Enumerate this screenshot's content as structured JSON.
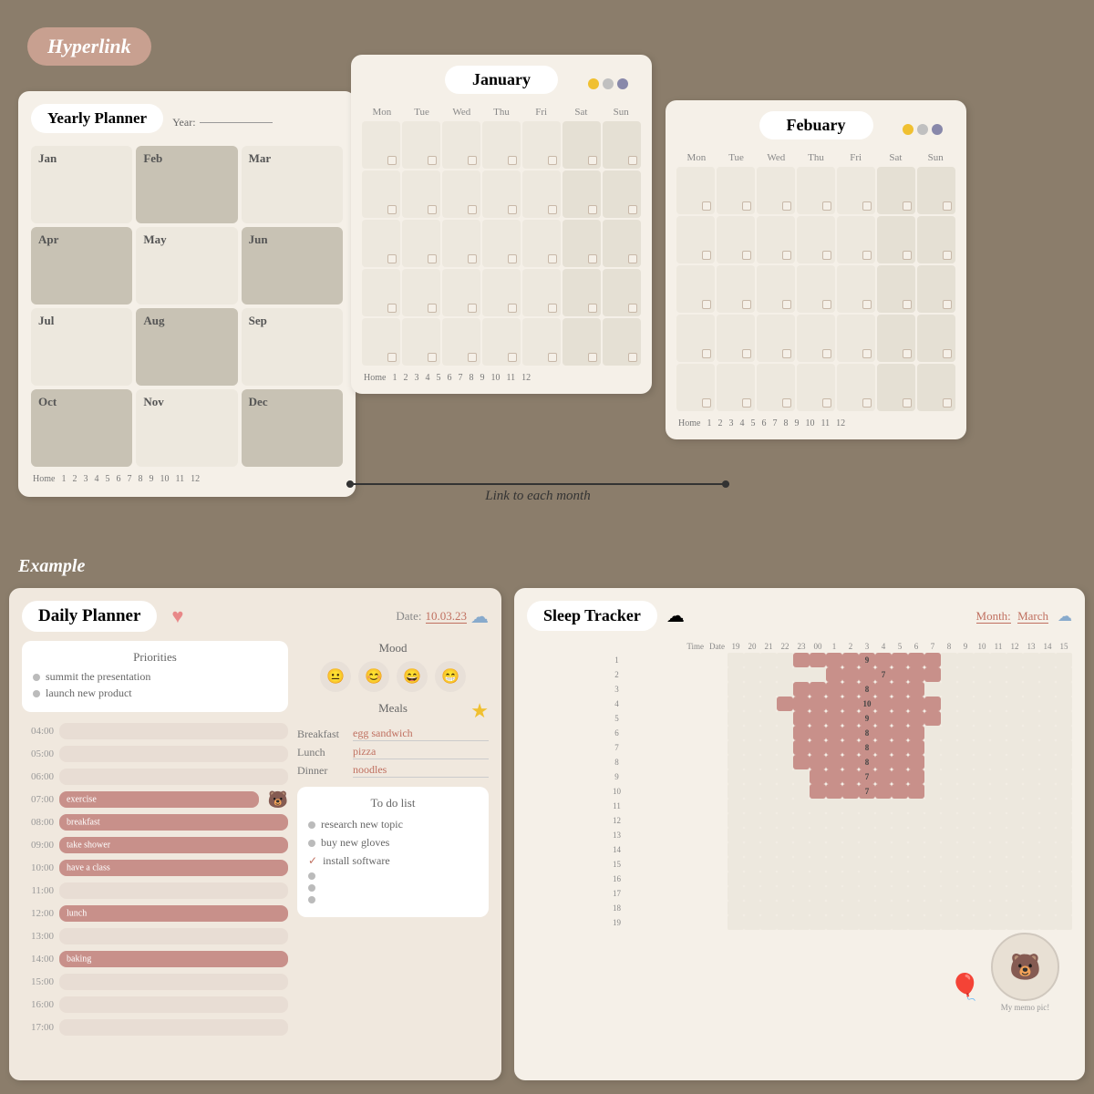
{
  "header": {
    "hyperlink_label": "Hyperlink"
  },
  "yearly_planner": {
    "title": "Yearly Planner",
    "year_label": "Year:",
    "months": [
      {
        "name": "Jan",
        "style": "light"
      },
      {
        "name": "Feb",
        "style": "medium"
      },
      {
        "name": "Mar",
        "style": "light"
      },
      {
        "name": "Apr",
        "style": "medium"
      },
      {
        "name": "May",
        "style": "light"
      },
      {
        "name": "Jun",
        "style": "medium"
      },
      {
        "name": "Jul",
        "style": "light"
      },
      {
        "name": "Aug",
        "style": "medium"
      },
      {
        "name": "Sep",
        "style": "light"
      },
      {
        "name": "Oct",
        "style": "medium"
      },
      {
        "name": "Nov",
        "style": "light"
      },
      {
        "name": "Dec",
        "style": "medium"
      }
    ],
    "nav": [
      "Home",
      "1",
      "2",
      "3",
      "4",
      "5",
      "6",
      "7",
      "8",
      "9",
      "10",
      "11",
      "12"
    ]
  },
  "january_calendar": {
    "title": "January",
    "days": [
      "Mon",
      "Tue",
      "Wed",
      "Thu",
      "Fri",
      "Sat",
      "Sun"
    ],
    "nav": [
      "Home",
      "1",
      "2",
      "3",
      "4",
      "5",
      "6",
      "7",
      "8",
      "9",
      "10",
      "11",
      "12"
    ],
    "controls": [
      {
        "color": "#f0c030"
      },
      {
        "color": "#c0c0c0"
      },
      {
        "color": "#8888aa"
      }
    ]
  },
  "february_calendar": {
    "title": "Febuary",
    "days": [
      "Mon",
      "Tue",
      "Wed",
      "Thu",
      "Fri",
      "Sat",
      "Sun"
    ],
    "nav": [
      "Home",
      "1",
      "2",
      "3",
      "4",
      "5",
      "6",
      "7",
      "8",
      "9",
      "10",
      "11",
      "12"
    ],
    "controls": [
      {
        "color": "#f0c030"
      },
      {
        "color": "#c0c0c0"
      },
      {
        "color": "#8888aa"
      }
    ]
  },
  "link_annotation": {
    "text": "Link to each month"
  },
  "example_label": "Example",
  "daily_planner": {
    "title": "Daily  Planner",
    "date_label": "Date:",
    "date_value": "10.03.23",
    "priorities": {
      "title": "Priorities",
      "items": [
        "summit the presentation",
        "launch new product"
      ]
    },
    "time_slots": [
      {
        "time": "04:00",
        "filled": false,
        "label": ""
      },
      {
        "time": "05:00",
        "filled": false,
        "label": ""
      },
      {
        "time": "06:00",
        "filled": false,
        "label": ""
      },
      {
        "time": "07:00",
        "filled": true,
        "label": "exercise"
      },
      {
        "time": "08:00",
        "filled": true,
        "label": "breakfast"
      },
      {
        "time": "09:00",
        "filled": true,
        "label": "take shower"
      },
      {
        "time": "10:00",
        "filled": true,
        "label": "have a class"
      },
      {
        "time": "11:00",
        "filled": false,
        "label": ""
      },
      {
        "time": "12:00",
        "filled": true,
        "label": "lunch"
      },
      {
        "time": "13:00",
        "filled": false,
        "label": ""
      },
      {
        "time": "14:00",
        "filled": true,
        "label": "baking"
      },
      {
        "time": "15:00",
        "filled": false,
        "label": ""
      },
      {
        "time": "16:00",
        "filled": false,
        "label": ""
      },
      {
        "time": "17:00",
        "filled": false,
        "label": ""
      }
    ],
    "mood": {
      "title": "Mood",
      "faces": [
        "😐",
        "😊",
        "😄",
        "😁"
      ]
    },
    "meals": {
      "title": "Meals",
      "items": [
        {
          "label": "Breakfast",
          "value": "egg sandwich"
        },
        {
          "label": "Lunch",
          "value": "pizza"
        },
        {
          "label": "Dinner",
          "value": "noodles"
        }
      ]
    },
    "todo": {
      "title": "To do list",
      "items": [
        {
          "text": "research new topic",
          "checked": false
        },
        {
          "text": "buy new gloves",
          "checked": false
        },
        {
          "text": "install software",
          "checked": true
        },
        {
          "text": "",
          "checked": false
        },
        {
          "text": "",
          "checked": false
        },
        {
          "text": "",
          "checked": false
        }
      ]
    }
  },
  "sleep_tracker": {
    "title": "Sleep Tracker",
    "month_label": "Month:",
    "month_value": "March",
    "time_headers": [
      "Time",
      "19",
      "20",
      "21",
      "22",
      "23",
      "00",
      "1",
      "2",
      "3",
      "4",
      "5",
      "6",
      "7",
      "8",
      "9",
      "10",
      "11",
      "12",
      "13",
      "14",
      "15"
    ],
    "rows": [
      {
        "day": "1",
        "start": 4,
        "length": 9,
        "value": "9"
      },
      {
        "day": "2",
        "start": 6,
        "length": 7,
        "value": "7"
      },
      {
        "day": "3",
        "start": 4,
        "length": 8,
        "value": "8"
      },
      {
        "day": "4",
        "start": 3,
        "length": 10,
        "value": "10"
      },
      {
        "day": "5",
        "start": 4,
        "length": 9,
        "value": "9"
      },
      {
        "day": "6",
        "start": 4,
        "length": 8,
        "value": "8"
      },
      {
        "day": "7",
        "start": 4,
        "length": 8,
        "value": "8"
      },
      {
        "day": "8",
        "start": 4,
        "length": 8,
        "value": "8"
      },
      {
        "day": "9",
        "start": 5,
        "length": 7,
        "value": "7"
      },
      {
        "day": "10",
        "start": 5,
        "length": 7,
        "value": "7"
      },
      {
        "day": "11",
        "start": 0,
        "length": 0,
        "value": ""
      },
      {
        "day": "12",
        "start": 0,
        "length": 0,
        "value": ""
      },
      {
        "day": "13",
        "start": 0,
        "length": 0,
        "value": ""
      },
      {
        "day": "14",
        "start": 0,
        "length": 0,
        "value": ""
      },
      {
        "day": "15",
        "start": 0,
        "length": 0,
        "value": ""
      },
      {
        "day": "16",
        "start": 0,
        "length": 0,
        "value": ""
      },
      {
        "day": "17",
        "start": 0,
        "length": 0,
        "value": ""
      },
      {
        "day": "18",
        "start": 0,
        "length": 0,
        "value": ""
      },
      {
        "day": "19",
        "start": 0,
        "length": 0,
        "value": ""
      }
    ],
    "bear_caption": "My memo pic!"
  }
}
